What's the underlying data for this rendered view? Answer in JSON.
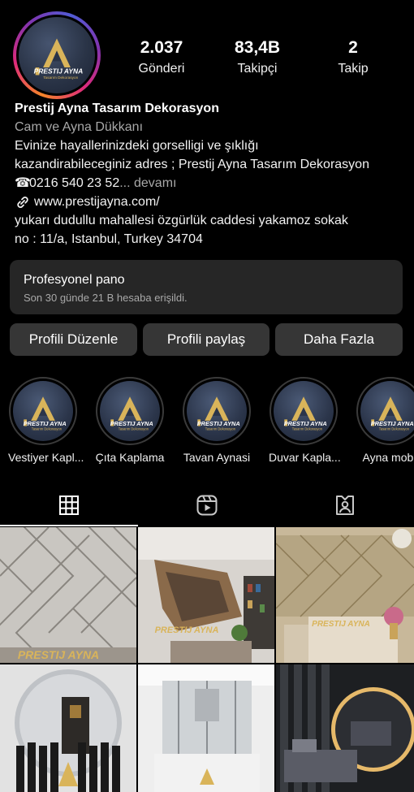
{
  "profile": {
    "stats": [
      {
        "value": "2.037",
        "label": "Gönderi"
      },
      {
        "value": "83,4B",
        "label": "Takipçi"
      },
      {
        "value": "2",
        "label": "Takip"
      }
    ],
    "name": "Prestij Ayna Tasarım Dekorasyon",
    "category": "Cam ve Ayna Dükkanı",
    "bio_line1": "Evinize hayallerinizdeki gorselligi ve şıklığı",
    "bio_line2": "kazandirabileceginiz adres ; Prestij Ayna Tasarım Dekorasyon",
    "phone_icon": "☎",
    "phone": "0216 540 23 52",
    "more": "... devamı",
    "website": "www.prestijayna.com/",
    "address_line1": "yukarı dudullu mahallesi özgürlük caddesi yakamoz sokak",
    "address_line2": "no : 11/a, Istanbul, Turkey 34704",
    "logo_text": "PRESTIJ AYNA",
    "logo_sub": "Tasarım Dekorasyon"
  },
  "dashboard": {
    "title": "Profesyonel pano",
    "subtitle": "Son 30 günde 21 B hesaba erişildi."
  },
  "buttons": {
    "edit": "Profili Düzenle",
    "share": "Profili paylaş",
    "more": "Daha Fazla"
  },
  "highlights": [
    {
      "label": "Vestiyer Kapl..."
    },
    {
      "label": "Çıta Kaplama"
    },
    {
      "label": "Tavan Aynasi"
    },
    {
      "label": "Duvar Kapla..."
    },
    {
      "label": "Ayna mobil"
    }
  ],
  "tabs": {
    "icons": [
      "grid-icon",
      "reels-icon",
      "tagged-icon"
    ],
    "active": 0
  },
  "posts": [
    {
      "watermark": "PRESTIJ AYNA"
    },
    {
      "watermark": "PRESTIJ AYNA"
    },
    {
      "watermark": "PRESTIJ AYNA"
    },
    {
      "watermark": ""
    },
    {
      "watermark": ""
    },
    {
      "watermark": ""
    }
  ],
  "colors": {
    "background": "#000000",
    "surface": "#262626",
    "button": "#363636",
    "muted_text": "#a8a8a8",
    "logo_gold": "#d9b45a"
  }
}
